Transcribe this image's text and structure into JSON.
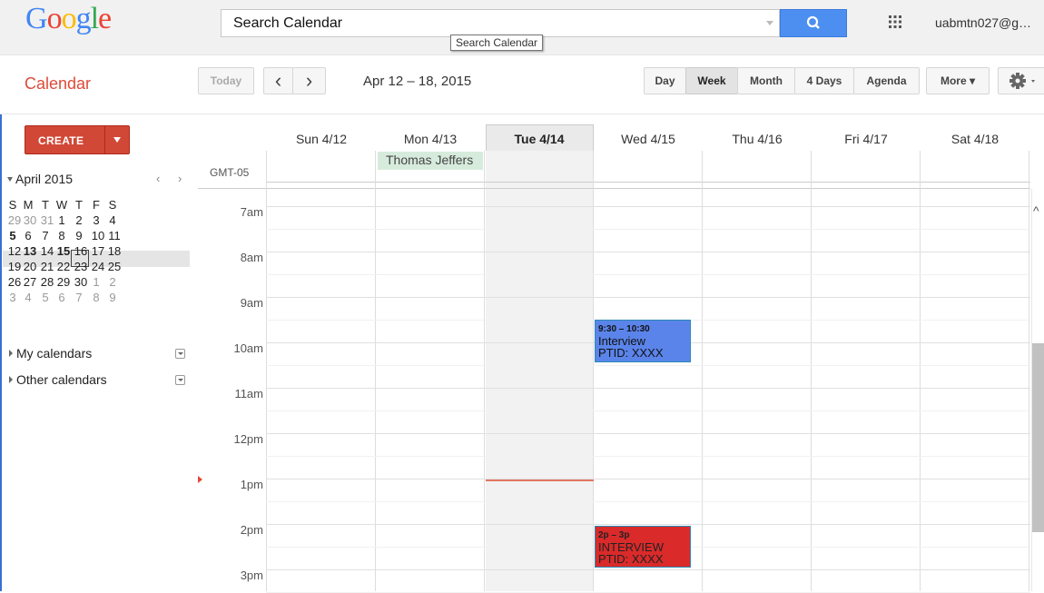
{
  "header": {
    "logo": [
      "G",
      "o",
      "o",
      "g",
      "l",
      "e"
    ],
    "logo_colors": [
      "#4285f4",
      "#ea4335",
      "#fbbc05",
      "#4285f4",
      "#34a853",
      "#ea4335"
    ],
    "search_placeholder": "Search Calendar",
    "search_tooltip": "Search Calendar",
    "account": "uabmtn027@g…"
  },
  "toolbar": {
    "app_name": "Calendar",
    "today": "Today",
    "prev": "‹",
    "next": "›",
    "date_range": "Apr 12 – 18, 2015",
    "views": {
      "day": "Day",
      "week": "Week",
      "month": "Month",
      "four_days": "4 Days",
      "agenda": "Agenda"
    },
    "more": "More ▾",
    "selected_view": "Week"
  },
  "sidebar": {
    "create": "CREATE",
    "mini_cal": {
      "title": "April 2015",
      "prev": "‹",
      "next": "›",
      "weekdays": [
        "S",
        "M",
        "T",
        "W",
        "T",
        "F",
        "S"
      ],
      "weeks": [
        [
          {
            "d": "29",
            "o": 1
          },
          {
            "d": "30",
            "o": 1
          },
          {
            "d": "31",
            "o": 1
          },
          {
            "d": "1"
          },
          {
            "d": "2"
          },
          {
            "d": "3"
          },
          {
            "d": "4"
          }
        ],
        [
          {
            "d": "5",
            "b": 1
          },
          {
            "d": "6"
          },
          {
            "d": "7"
          },
          {
            "d": "8"
          },
          {
            "d": "9"
          },
          {
            "d": "10"
          },
          {
            "d": "11"
          }
        ],
        [
          {
            "d": "12"
          },
          {
            "d": "13",
            "b": 1
          },
          {
            "d": "14"
          },
          {
            "d": "15",
            "b": 1
          },
          {
            "d": "16"
          },
          {
            "d": "17"
          },
          {
            "d": "18"
          }
        ],
        [
          {
            "d": "19"
          },
          {
            "d": "20"
          },
          {
            "d": "21"
          },
          {
            "d": "22"
          },
          {
            "d": "23"
          },
          {
            "d": "24"
          },
          {
            "d": "25"
          }
        ],
        [
          {
            "d": "26"
          },
          {
            "d": "27"
          },
          {
            "d": "28"
          },
          {
            "d": "29"
          },
          {
            "d": "30"
          },
          {
            "d": "1",
            "o": 1
          },
          {
            "d": "2",
            "o": 1
          }
        ],
        [
          {
            "d": "3",
            "o": 1
          },
          {
            "d": "4",
            "o": 1
          },
          {
            "d": "5",
            "o": 1
          },
          {
            "d": "6",
            "o": 1
          },
          {
            "d": "7",
            "o": 1
          },
          {
            "d": "8",
            "o": 1
          },
          {
            "d": "9",
            "o": 1
          }
        ]
      ],
      "today_date": "14"
    },
    "my_calendars": "My calendars",
    "other_calendars": "Other calendars"
  },
  "grid": {
    "timezone": "GMT-05",
    "days": [
      "Sun 4/12",
      "Mon 4/13",
      "Tue 4/14",
      "Wed 4/15",
      "Thu 4/16",
      "Fri 4/17",
      "Sat 4/18"
    ],
    "today_label": "Tue 4/14",
    "hours": [
      "7am",
      "8am",
      "9am",
      "10am",
      "11am",
      "12pm",
      "1pm",
      "2pm",
      "3pm"
    ],
    "allday_event": "Thomas Jeffers",
    "events": [
      {
        "time": "9:30 – 10:30",
        "title": "Interview",
        "detail": "PTID: XXXX",
        "color": "#5b84ea"
      },
      {
        "time": "2p – 3p",
        "title": "INTERVIEW",
        "detail": "PTID: XXXX",
        "color": "#da2a2a"
      }
    ]
  }
}
